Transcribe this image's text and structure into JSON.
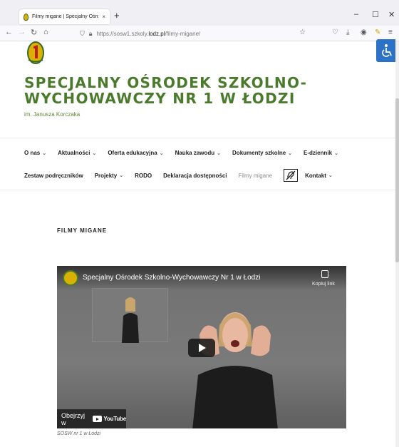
{
  "browser": {
    "tab_title": "Filmy migane | Specjalny Ośrod",
    "tab_close": "×",
    "new_tab": "+",
    "url_prefix": "https://sosw1.szkoly.",
    "url_domain": "lodz.pl",
    "url_path": "/filmy-migane/"
  },
  "site": {
    "title_line1": "SPECJALNY OŚRODEK SZKOLNO-",
    "title_line2": "WYCHOWAWCZY NR 1 W ŁODZI",
    "subtitle": "im. Janusza Korczaka"
  },
  "menu": {
    "row1": [
      {
        "label": "O nas",
        "dropdown": true
      },
      {
        "label": "Aktualności",
        "dropdown": true
      },
      {
        "label": "Oferta edukacyjna",
        "dropdown": true
      },
      {
        "label": "Nauka zawodu",
        "dropdown": true
      },
      {
        "label": "Dokumenty szkolne",
        "dropdown": true
      },
      {
        "label": "E-dziennik",
        "dropdown": true
      }
    ],
    "row2": [
      {
        "label": "Zestaw podręczników",
        "dropdown": false
      },
      {
        "label": "Projekty",
        "dropdown": true
      },
      {
        "label": "RODO",
        "dropdown": false
      },
      {
        "label": "Deklaracja dostępności",
        "dropdown": false
      },
      {
        "label": "Filmy migane",
        "dropdown": false,
        "active": true
      },
      {
        "label": "Kontakt",
        "dropdown": true
      }
    ]
  },
  "page": {
    "entry_title": "FILMY MIGANE"
  },
  "video": {
    "title": "Specjalny Ośrodek Szkolno-Wychowawczy Nr 1 w Łodzi",
    "copy_link": "Kopiuj link",
    "watch_on": "Obejrzyj w",
    "youtube": "YouTube",
    "caption": "SOSW nr 1 w Łodzi"
  },
  "colors": {
    "brand_green": "#4a7b2c",
    "accessibility_blue": "#2c72c7"
  }
}
